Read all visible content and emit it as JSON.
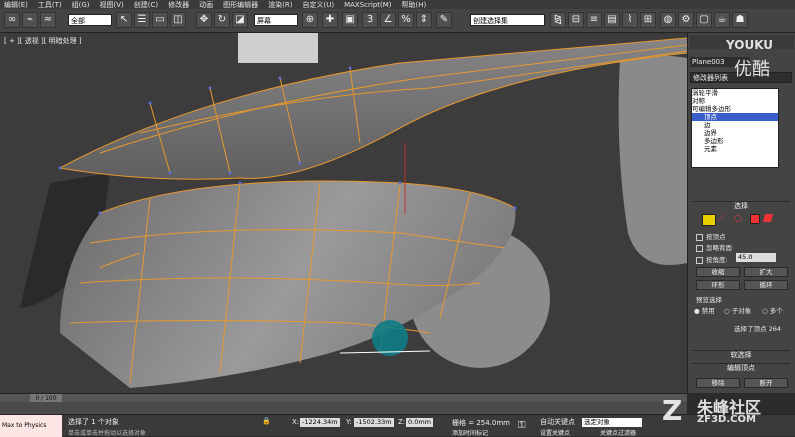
{
  "menu": [
    "编辑(E)",
    "工具(T)",
    "组(G)",
    "视图(V)",
    "创建(C)",
    "修改器",
    "动画",
    "图形编辑器",
    "渲染(R)",
    "自定义(U)",
    "MAXScript(M)",
    "帮助(H)"
  ],
  "toolbar": {
    "selection_filter": "全部",
    "ref_coord": "屏幕",
    "named_selection": "创建选择集"
  },
  "viewport": {
    "label": "[ + ][ 透视 ][ 明暗处理 ]"
  },
  "command_panel": {
    "object_name": "Plane003",
    "modifier_list": "修改器列表",
    "stack": [
      {
        "label": "涡轮平滑",
        "selected": false
      },
      {
        "label": "对称",
        "selected": false
      },
      {
        "label": "可编辑多边形",
        "selected": false
      },
      {
        "label": "顶点",
        "selected": true
      },
      {
        "label": "边",
        "selected": false
      },
      {
        "label": "边界",
        "selected": false
      },
      {
        "label": "多边形",
        "selected": false
      },
      {
        "label": "元素",
        "selected": false
      }
    ],
    "selection_title": "选择",
    "by_vertex": "按顶点",
    "ignore_backface": "忽略背面",
    "by_angle": "按角度:",
    "angle_value": "45.0",
    "shrink": "收缩",
    "grow": "扩大",
    "ring": "环形",
    "loop": "循环",
    "preview_title": "预览选择",
    "preview_disabled": "禁用",
    "preview_subobj": "子对象",
    "preview_multi": "多个",
    "selected_count": "选择了顶点 264",
    "soft_selection": "软选择",
    "edit_vertices": "编辑顶点",
    "remove": "移除",
    "break": "断开"
  },
  "timeline": {
    "frame": "0 / 100"
  },
  "status": {
    "maxscript": "Max to Physics",
    "selected": "选择了 1 个对象",
    "prompt": "单击或单击并拖动以选择对象",
    "x_label": "X:",
    "x_value": "-1224.34m",
    "y_label": "Y:",
    "y_value": "-1502.33m",
    "z_label": "Z:",
    "z_value": "0.0mm",
    "grid": "栅格 = 254.0mm",
    "autokey": "自动关键点",
    "set_key": "设置关键点",
    "key_filter": "选定对象",
    "add_time_tag": "添加时间标记",
    "key_filters_btn": "关键点过滤器"
  },
  "watermark": {
    "youku_top": "YOUKU",
    "youku_cn": "优酷",
    "site_cn": "朱峰社区",
    "site_url": "ZF3D.COM"
  }
}
